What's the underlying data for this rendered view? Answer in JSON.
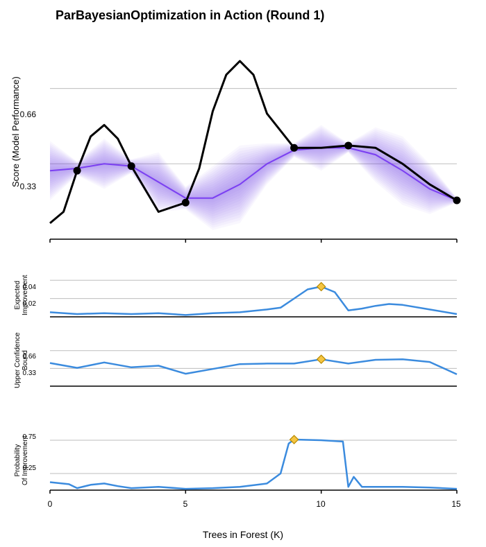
{
  "title": "ParBayesianOptimization in Action (Round 1)",
  "xlabel": "Trees in Forest (K)",
  "x_range": [
    0,
    15
  ],
  "x_ticks": [
    0,
    5,
    10,
    15
  ],
  "panels": {
    "main": {
      "ylabel": "Score (Model Performance)",
      "y_ticks": [
        0.33,
        0.66
      ],
      "y_range": [
        0.0,
        0.85
      ]
    },
    "ei": {
      "ylabel": "Expected\nImprovement",
      "y_ticks": [
        0.02,
        0.04
      ],
      "y_range": [
        0.0,
        0.05
      ]
    },
    "ucb": {
      "ylabel": "Upper Confidence\nBound",
      "y_ticks": [
        0.33,
        0.66
      ],
      "y_range": [
        0.0,
        0.85
      ]
    },
    "pi": {
      "ylabel": "Probability\nOf Improvement",
      "y_ticks": [
        0.25,
        0.75
      ],
      "y_range": [
        0.0,
        1.0
      ]
    }
  },
  "chart_data": [
    {
      "type": "line",
      "name": "main-gp",
      "title": "ParBayesianOptimization in Action (Round 1)",
      "xlabel": "Trees in Forest (K)",
      "ylabel": "Score (Model Performance)",
      "x_range": [
        0,
        15
      ],
      "y_range": [
        0.0,
        0.85
      ],
      "gp_mean": {
        "x": [
          0,
          1,
          2,
          3,
          4,
          5,
          6,
          7,
          8,
          9,
          10,
          11,
          12,
          13,
          14,
          15
        ],
        "y": [
          0.3,
          0.31,
          0.33,
          0.32,
          0.25,
          0.18,
          0.18,
          0.24,
          0.33,
          0.39,
          0.4,
          0.4,
          0.37,
          0.3,
          0.22,
          0.17
        ]
      },
      "gp_band_half_width": {
        "x": [
          0,
          1,
          2,
          3,
          4,
          5,
          6,
          7,
          8,
          9,
          10,
          11,
          12,
          13,
          14,
          15
        ],
        "y": [
          0.13,
          0.03,
          0.11,
          0.03,
          0.13,
          0.05,
          0.14,
          0.17,
          0.09,
          0.03,
          0.1,
          0.02,
          0.12,
          0.15,
          0.11,
          0.01
        ]
      },
      "objective": {
        "x": [
          0,
          0.5,
          1.0,
          1.5,
          2.0,
          2.5,
          3.0,
          4.0,
          5.0,
          5.5,
          6.0,
          6.5,
          7.0,
          7.5,
          8.0,
          9.0,
          10.0,
          11.0,
          12.0,
          13.0,
          14.0,
          15.0
        ],
        "y": [
          0.07,
          0.12,
          0.3,
          0.45,
          0.5,
          0.44,
          0.32,
          0.12,
          0.16,
          0.31,
          0.56,
          0.72,
          0.78,
          0.72,
          0.55,
          0.4,
          0.4,
          0.41,
          0.4,
          0.33,
          0.24,
          0.17
        ]
      },
      "sample_points": {
        "x": [
          1,
          3,
          5,
          9,
          11,
          15
        ],
        "y": [
          0.3,
          0.32,
          0.16,
          0.4,
          0.41,
          0.17
        ]
      }
    },
    {
      "type": "line",
      "name": "expected-improvement",
      "ylabel": "Expected Improvement",
      "y_range": [
        0.0,
        0.05
      ],
      "series": {
        "x": [
          0,
          1,
          2,
          3,
          4,
          5,
          6,
          7,
          8,
          8.5,
          9,
          9.5,
          10,
          10.5,
          11,
          11.5,
          12,
          12.5,
          13,
          14,
          15
        ],
        "y": [
          0.005,
          0.003,
          0.004,
          0.003,
          0.004,
          0.002,
          0.004,
          0.005,
          0.008,
          0.01,
          0.02,
          0.03,
          0.033,
          0.027,
          0.007,
          0.009,
          0.012,
          0.014,
          0.013,
          0.008,
          0.003
        ]
      },
      "marker": {
        "x": 10,
        "y": 0.033
      }
    },
    {
      "type": "line",
      "name": "upper-confidence-bound",
      "ylabel": "Upper Confidence Bound",
      "y_range": [
        0.0,
        0.85
      ],
      "series": {
        "x": [
          0,
          1,
          2,
          3,
          4,
          5,
          6,
          7,
          8,
          9,
          10,
          11,
          12,
          13,
          14,
          15
        ],
        "y": [
          0.43,
          0.34,
          0.44,
          0.35,
          0.38,
          0.23,
          0.32,
          0.41,
          0.42,
          0.42,
          0.5,
          0.42,
          0.49,
          0.5,
          0.45,
          0.22
        ]
      },
      "marker": {
        "x": 10,
        "y": 0.5
      }
    },
    {
      "type": "line",
      "name": "probability-of-improvement",
      "ylabel": "Probability Of Improvement",
      "y_range": [
        0.0,
        1.0
      ],
      "series": {
        "x": [
          0,
          0.7,
          1,
          1.5,
          2,
          2.5,
          3,
          4,
          5,
          6,
          7,
          8,
          8.5,
          8.8,
          9,
          10,
          10.8,
          11,
          11.2,
          11.5,
          12,
          13,
          14,
          15
        ],
        "y": [
          0.12,
          0.09,
          0.03,
          0.08,
          0.1,
          0.06,
          0.03,
          0.05,
          0.02,
          0.03,
          0.05,
          0.1,
          0.25,
          0.7,
          0.76,
          0.75,
          0.73,
          0.05,
          0.2,
          0.05,
          0.05,
          0.05,
          0.04,
          0.02
        ]
      },
      "marker": {
        "x": 9,
        "y": 0.76
      }
    }
  ]
}
